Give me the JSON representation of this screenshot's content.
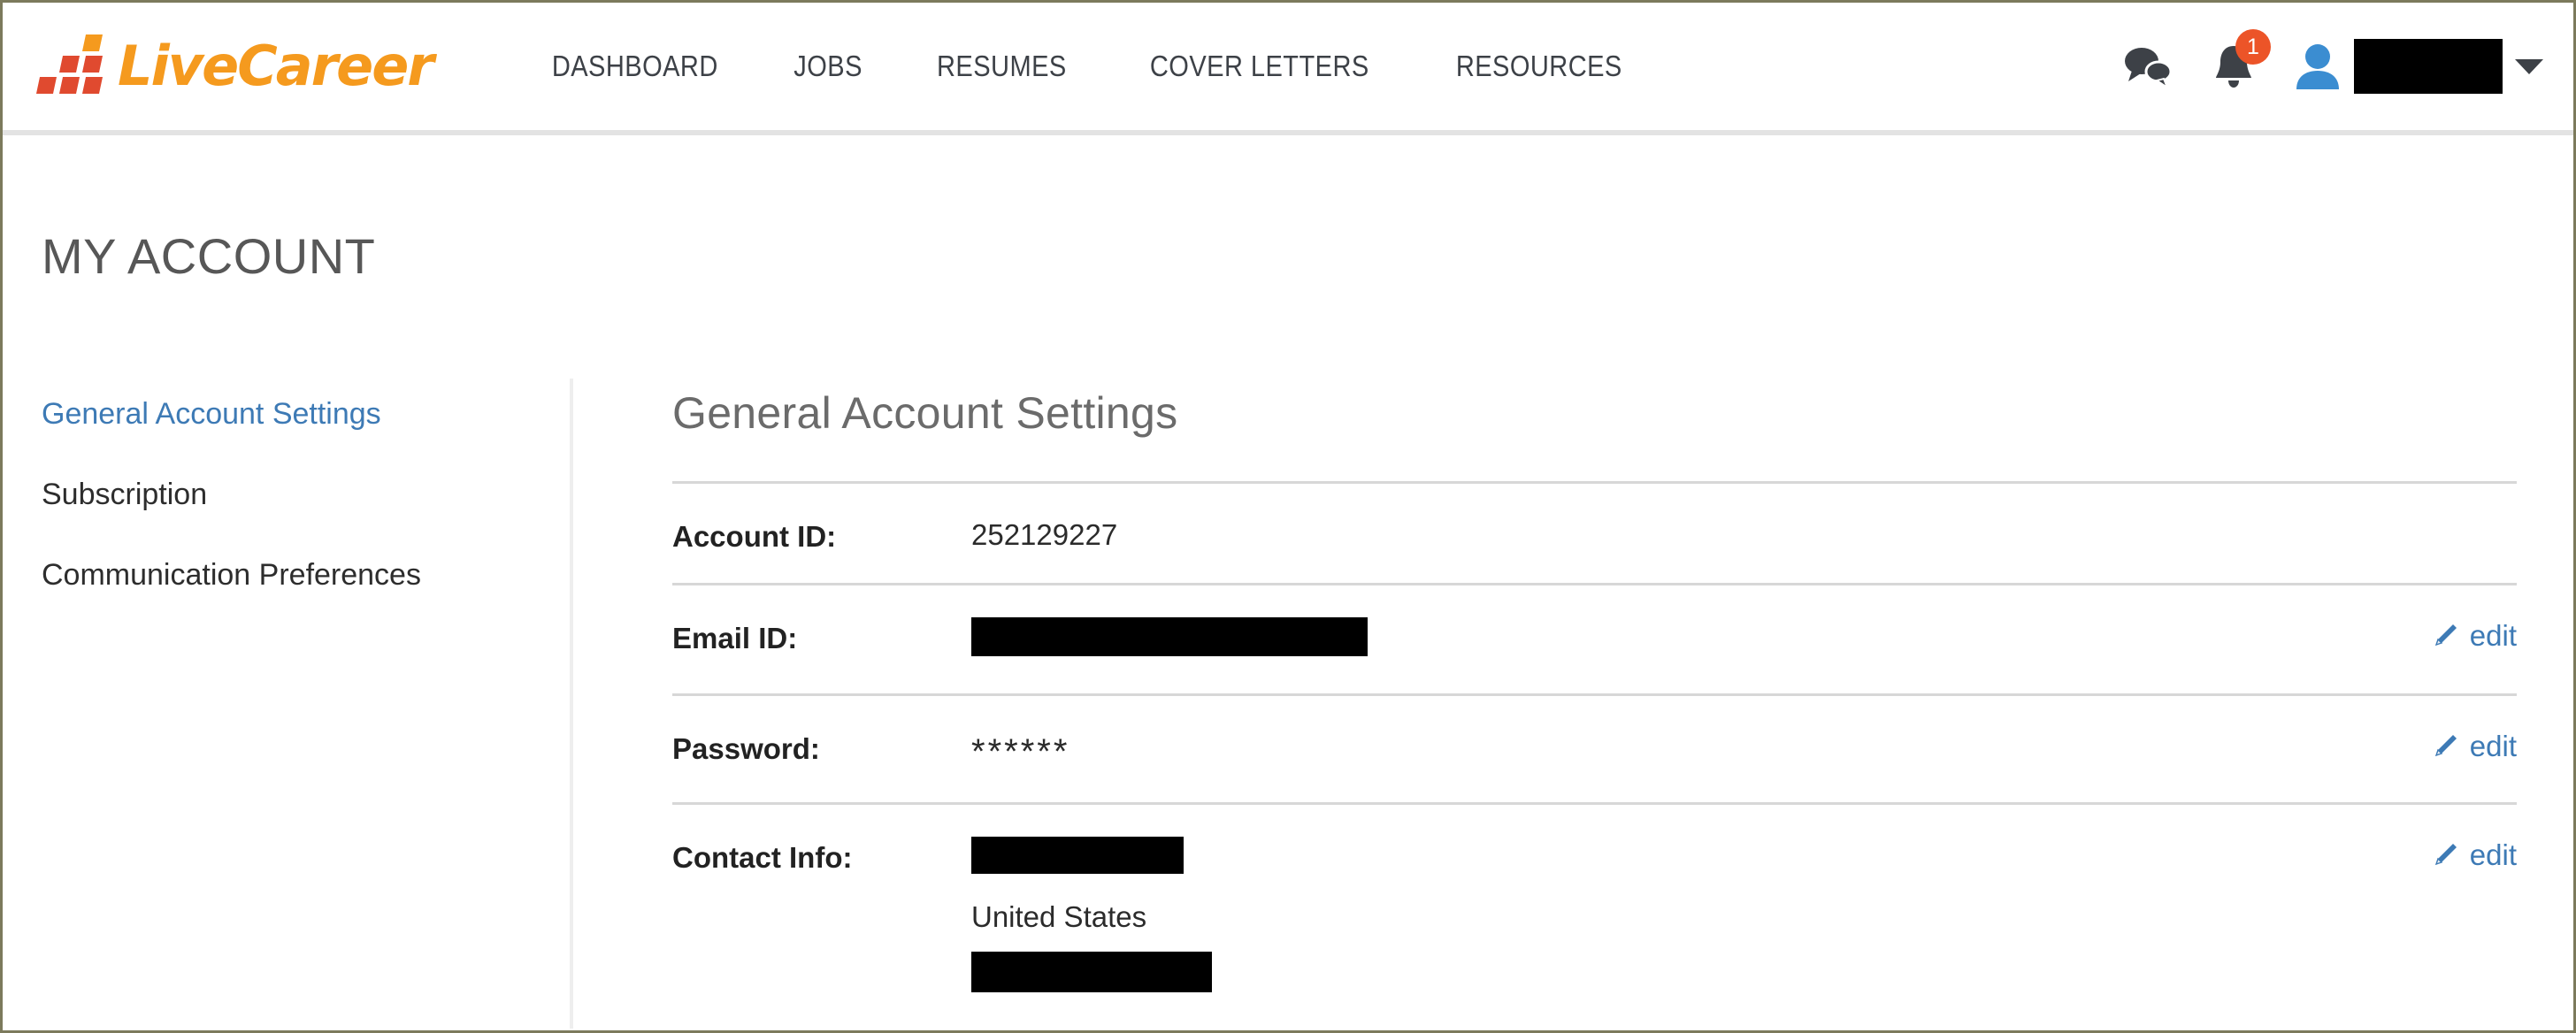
{
  "brand": {
    "name": "LiveCareer",
    "logo_orange": "#f59a1e",
    "logo_red": "#e04a2f"
  },
  "header": {
    "nav": [
      {
        "label": "DASHBOARD"
      },
      {
        "label": "JOBS"
      },
      {
        "label": "RESUMES"
      },
      {
        "label": "COVER LETTERS"
      },
      {
        "label": "RESOURCES"
      }
    ],
    "messages_icon": "chat-bubbles-icon",
    "notifications": {
      "icon": "bell-icon",
      "badge_count": "1",
      "badge_color": "#ec5428"
    },
    "account": {
      "icon": "person-icon",
      "username": "",
      "username_redacted": true,
      "caret": "chevron-down-icon"
    }
  },
  "page": {
    "title": "MY ACCOUNT"
  },
  "sidebar": {
    "items": [
      {
        "label": "General Account Settings",
        "active": true
      },
      {
        "label": "Subscription",
        "active": false
      },
      {
        "label": "Communication Preferences",
        "active": false
      }
    ],
    "active_color": "#3d7ab5"
  },
  "main": {
    "title": "General Account Settings",
    "edit_label": "edit",
    "edit_icon": "pencil-icon",
    "link_color": "#3d7ab5",
    "rows": [
      {
        "label": "Account ID:",
        "value": "252129227",
        "redacted": false,
        "editable": false
      },
      {
        "label": "Email ID:",
        "value": "",
        "redacted": true,
        "editable": true
      },
      {
        "label": "Password:",
        "value": "******",
        "redacted": false,
        "editable": true
      },
      {
        "label": "Contact Info:",
        "value_name_redacted": true,
        "value_country": "United States",
        "value_phone_redacted": true,
        "editable": true
      }
    ]
  }
}
